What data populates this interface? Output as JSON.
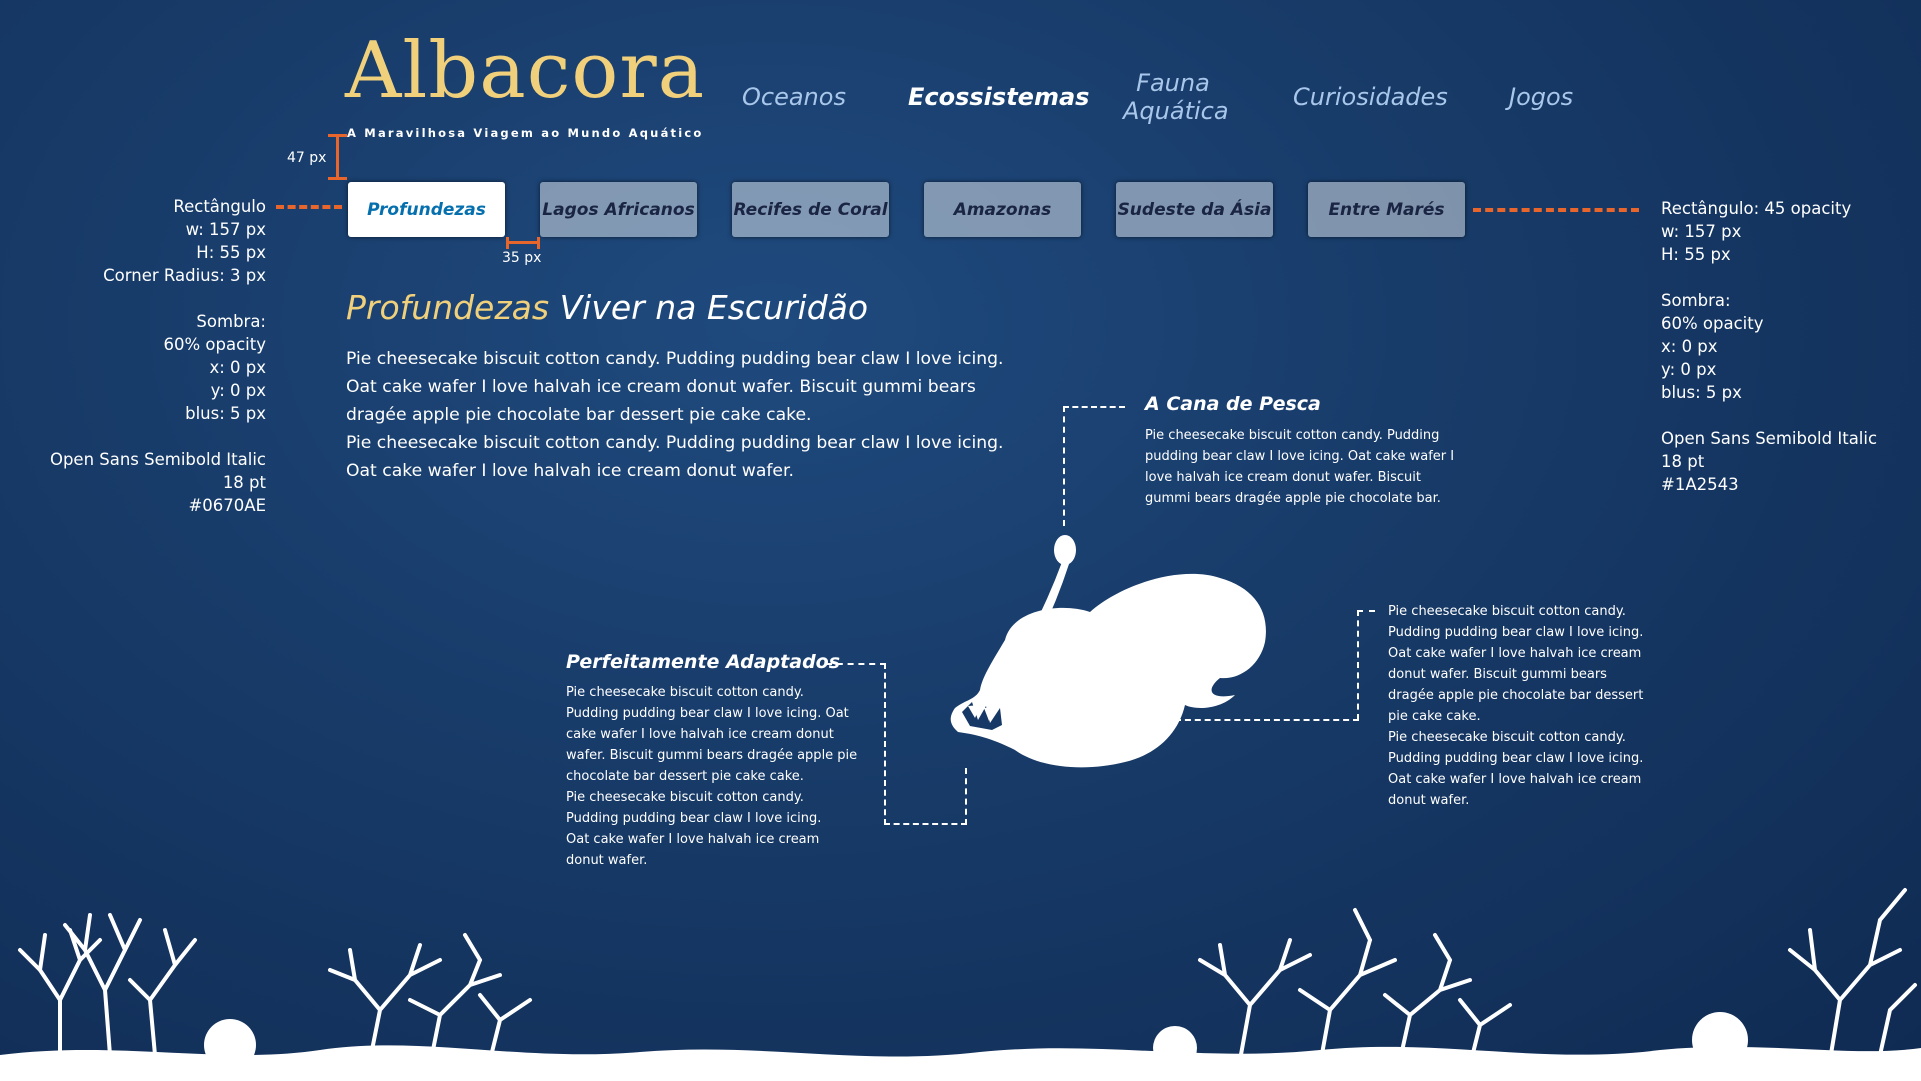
{
  "logo": {
    "title": "Albacora",
    "subtitle": "A Maravilhosa Viagem ao Mundo Aquático"
  },
  "nav": {
    "items": [
      {
        "label": "Oceanos"
      },
      {
        "label": "Ecossistemas",
        "active": true
      },
      {
        "label_line1": "Fauna",
        "label_line2": "Aquática"
      },
      {
        "label": "Curiosidades"
      },
      {
        "label": "Jogos"
      }
    ]
  },
  "tabs": [
    {
      "label": "Profundezas",
      "active": true
    },
    {
      "label": "Lagos Africanos"
    },
    {
      "label": "Recifes de Coral"
    },
    {
      "label": "Amazonas"
    },
    {
      "label": "Sudeste da Ásia"
    },
    {
      "label": "Entre Marés"
    }
  ],
  "measurements": {
    "vertical_gap": "47 px",
    "horizontal_gap": "35 px"
  },
  "annotations": {
    "left": {
      "lines": [
        "Rectângulo",
        "w: 157 px",
        "H: 55 px",
        "Corner Radius: 3 px",
        "",
        "Sombra:",
        "60% opacity",
        "x: 0 px",
        "y: 0 px",
        "blus: 5 px",
        "",
        "Open Sans Semibold Italic",
        "18 pt",
        "#0670AE"
      ]
    },
    "right": {
      "lines": [
        "Rectângulo: 45 opacity",
        "w: 157 px",
        "H: 55 px",
        "",
        "Sombra:",
        "60% opacity",
        "x: 0 px",
        "y: 0 px",
        "blus: 5 px",
        "",
        "Open Sans Semibold Italic",
        "18 pt",
        "#1A2543"
      ]
    }
  },
  "content": {
    "heading_accent": "Profundezas",
    "heading_rest": "Viver na Escuridão",
    "body_lines": [
      "Pie cheesecake biscuit cotton candy. Pudding pudding bear claw I love icing.",
      "Oat cake wafer I love halvah ice cream donut wafer. Biscuit gummi bears",
      "dragée apple pie chocolate bar dessert pie cake cake.",
      "Pie cheesecake biscuit cotton candy. Pudding pudding bear claw I love icing.",
      "Oat cake wafer I love halvah ice cream donut wafer."
    ]
  },
  "callouts": {
    "pesca": {
      "title": "A Cana de Pesca",
      "lines": [
        "Pie cheesecake biscuit cotton candy. Pudding",
        "pudding bear claw I love icing. Oat cake wafer I",
        "love halvah ice cream donut wafer. Biscuit",
        "gummi bears dragée apple pie chocolate bar."
      ]
    },
    "adaptados": {
      "title": "Perfeitamente Adaptados",
      "lines": [
        "Pie cheesecake biscuit cotton candy.",
        "Pudding pudding bear claw I love icing. Oat",
        "cake wafer I love halvah ice cream donut",
        "wafer. Biscuit gummi bears dragée apple pie",
        "chocolate bar dessert pie cake cake.",
        "Pie cheesecake biscuit cotton candy.",
        "Pudding pudding bear claw I love icing.",
        "Oat cake wafer I love halvah ice cream",
        "donut wafer."
      ]
    },
    "right": {
      "lines": [
        "Pie cheesecake biscuit cotton candy.",
        "Pudding pudding bear claw I love icing.",
        "Oat cake wafer I love halvah ice cream",
        "donut wafer. Biscuit gummi bears",
        "dragée apple pie chocolate bar dessert",
        "pie cake cake.",
        "Pie cheesecake biscuit cotton candy.",
        "Pudding pudding bear claw I love icing.",
        "Oat cake wafer I love halvah ice cream",
        "donut wafer."
      ]
    }
  },
  "icons": {
    "fish": "anglerfish-silhouette-icon",
    "coral": "coral-silhouette-icon"
  },
  "colors": {
    "accent": "#f1d07c",
    "active_tab_text": "#0670AE",
    "tab_text": "#1A2543",
    "annotation_line": "#e8662b"
  }
}
